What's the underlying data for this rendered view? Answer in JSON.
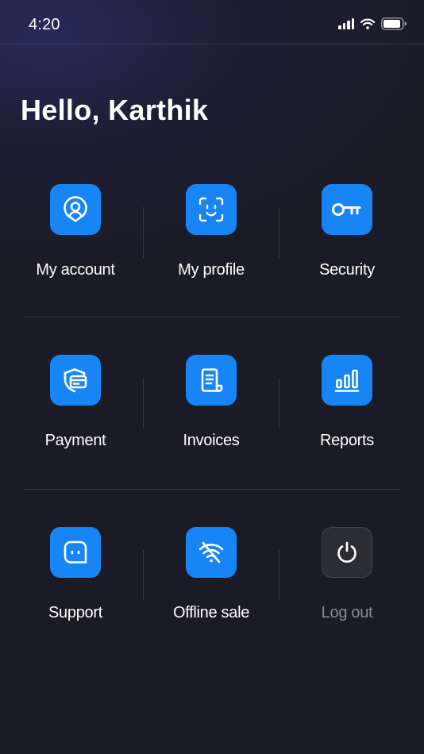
{
  "status_bar": {
    "time": "4:20"
  },
  "greeting": "Hello, Karthik",
  "accent_color": "#1785f5",
  "menu": [
    {
      "label": "My account",
      "icon": "user-circle-icon"
    },
    {
      "label": "My profile",
      "icon": "face-scan-icon"
    },
    {
      "label": "Security",
      "icon": "key-icon"
    },
    {
      "label": "Payment",
      "icon": "card-shield-icon"
    },
    {
      "label": "Invoices",
      "icon": "document-icon"
    },
    {
      "label": "Reports",
      "icon": "bar-chart-icon"
    },
    {
      "label": "Support",
      "icon": "chat-bubble-icon"
    },
    {
      "label": "Offline sale",
      "icon": "wifi-off-icon"
    },
    {
      "label": "Log out",
      "icon": "power-icon"
    }
  ]
}
